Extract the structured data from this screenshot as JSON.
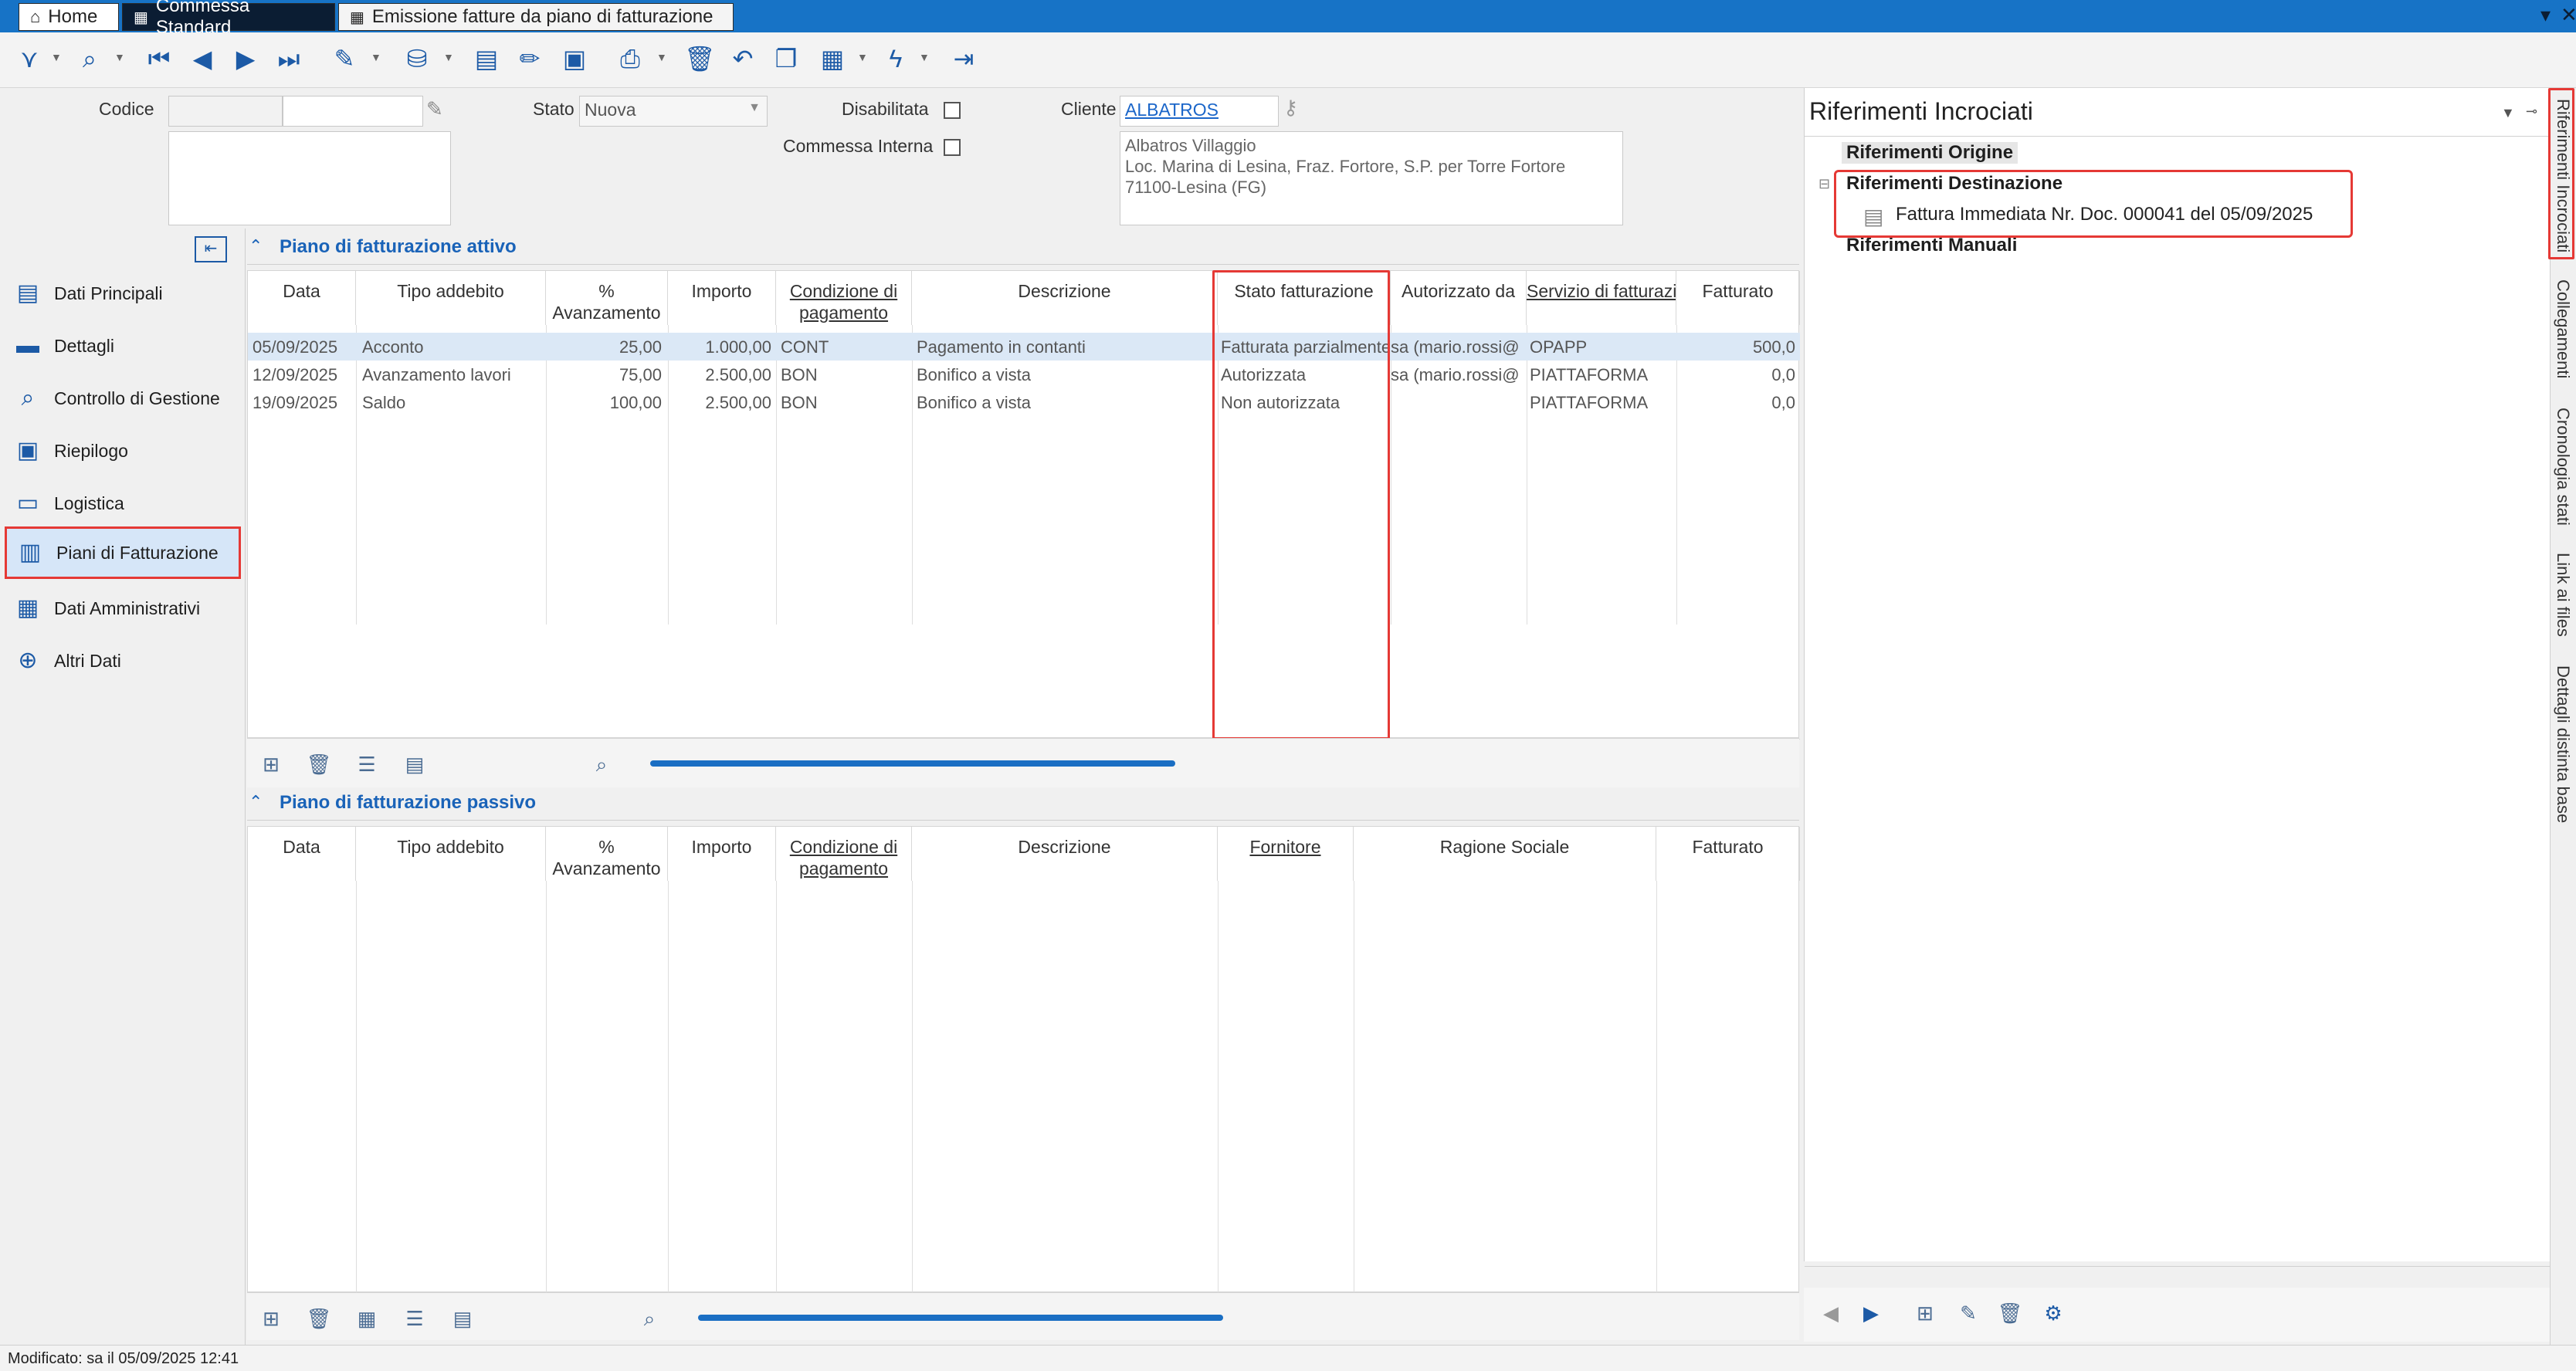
{
  "tabs": [
    {
      "label": "Home"
    },
    {
      "label": "Commessa Standard"
    },
    {
      "label": "Emissione fatture da piano di fatturazione"
    }
  ],
  "header": {
    "codice_label": "Codice",
    "stato_label": "Stato",
    "stato_value": "Nuova",
    "disabilitata_label": "Disabilitata",
    "commessa_interna_label": "Commessa Interna",
    "cliente_label": "Cliente",
    "cliente_value": "ALBATROS",
    "cliente_address": [
      "Albatros Villaggio",
      "Loc. Marina di Lesina, Fraz. Fortore, S.P. per Torre Fortore",
      "71100-Lesina (FG)"
    ]
  },
  "nav": {
    "items": [
      {
        "label": "Dati Principali"
      },
      {
        "label": "Dettagli"
      },
      {
        "label": "Controllo di Gestione"
      },
      {
        "label": "Riepilogo"
      },
      {
        "label": "Logistica"
      },
      {
        "label": "Piani di Fatturazione"
      },
      {
        "label": "Dati Amministrativi"
      },
      {
        "label": "Altri Dati"
      }
    ]
  },
  "attivo": {
    "title": "Piano di fatturazione attivo",
    "columns": [
      "Data",
      "Tipo addebito",
      "% Avanzamento",
      "Importo",
      "Condizione di pagamento",
      "Descrizione",
      "Stato fatturazione",
      "Autorizzato da",
      "Servizio di fatturazione",
      "Fatturato"
    ],
    "rows": [
      [
        "05/09/2025",
        "Acconto",
        "25,00",
        "1.000,00",
        "CONT",
        "Pagamento in contanti",
        "Fatturata parzialmente",
        "sa (mario.rossi@",
        "OPAPP",
        "500,0"
      ],
      [
        "12/09/2025",
        "Avanzamento lavori",
        "75,00",
        "2.500,00",
        "BON",
        "Bonifico a vista",
        "Autorizzata",
        "sa (mario.rossi@",
        "PIATTAFORMA",
        "0,0"
      ],
      [
        "19/09/2025",
        "Saldo",
        "100,00",
        "2.500,00",
        "BON",
        "Bonifico a vista",
        "Non autorizzata",
        "",
        "PIATTAFORMA",
        "0,0"
      ]
    ]
  },
  "passivo": {
    "title": "Piano di fatturazione passivo",
    "columns": [
      "Data",
      "Tipo addebito",
      "% Avanzamento",
      "Importo",
      "Condizione di pagamento",
      "Descrizione",
      "Fornitore",
      "Ragione Sociale",
      "Fatturato"
    ]
  },
  "right_panel": {
    "title": "Riferimenti Incrociati",
    "origine": "Riferimenti Origine",
    "destinazione": "Riferimenti Destinazione",
    "fattura": "Fattura Immediata Nr. Doc. 000041 del 05/09/2025",
    "manuali": "Riferimenti Manuali"
  },
  "vertical_tabs": [
    "Riferimenti Incrociati",
    "Collegamenti",
    "Cronologia stati",
    "Link ai files",
    "Dettagli distinta base"
  ],
  "status": "Modificato: sa il 05/09/2025 12:41",
  "colors": {
    "accent": "#1773c6",
    "highlight": "#e53935",
    "link": "#1b66c9"
  }
}
